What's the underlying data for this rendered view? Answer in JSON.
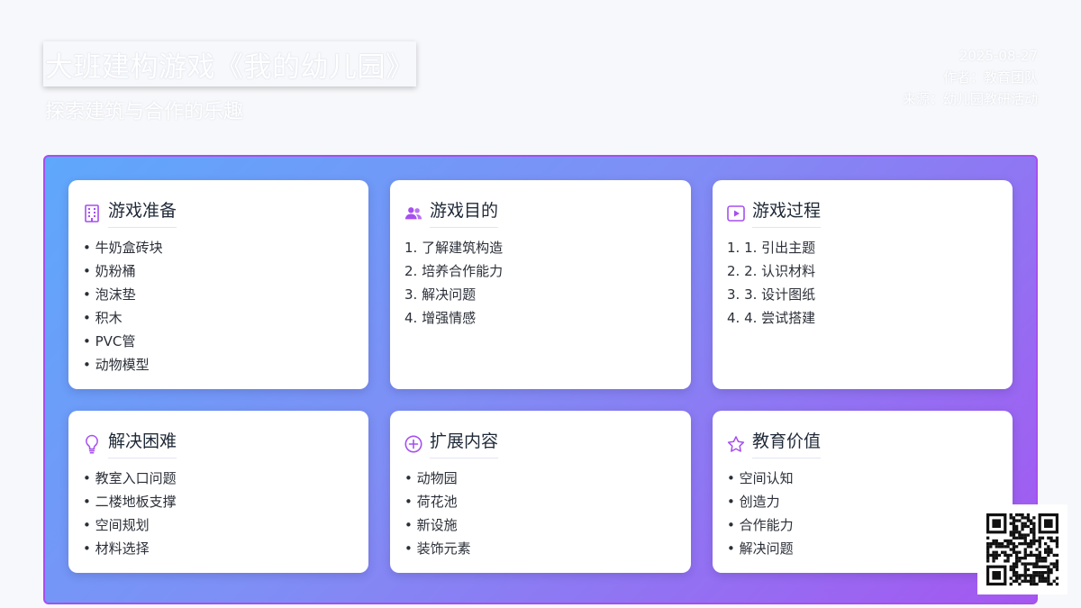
{
  "header": {
    "title": "大班建构游戏《我的幼儿园》",
    "subtitle": "探索建筑与合作的乐趣",
    "date": "2025-08-27",
    "author": "作者：教育团队",
    "source": "来源：幼儿园教研活动"
  },
  "cards": [
    {
      "title": "游戏准备",
      "icon": "building-icon",
      "items": [
        "• 牛奶盒砖块",
        "• 奶粉桶",
        "• 泡沫垫",
        "• 积木",
        "• PVC管",
        "• 动物模型"
      ]
    },
    {
      "title": "游戏目的",
      "icon": "users-icon",
      "items": [
        "1. 了解建筑构造",
        "2. 培养合作能力",
        "3. 解决问题",
        "4. 增强情感"
      ]
    },
    {
      "title": "游戏过程",
      "icon": "play-icon",
      "items": [
        "1. 1. 引出主题",
        "2. 2. 认识材料",
        "3. 3. 设计图纸",
        "4. 4. 尝试搭建"
      ]
    },
    {
      "title": "解决困难",
      "icon": "lightbulb-icon",
      "items": [
        "• 教室入口问题",
        "• 二楼地板支撑",
        "• 空间规划",
        "• 材料选择"
      ]
    },
    {
      "title": "扩展内容",
      "icon": "plus-circle-icon",
      "items": [
        "• 动物园",
        "• 荷花池",
        "• 新设施",
        "• 装饰元素"
      ]
    },
    {
      "title": "教育价值",
      "icon": "star-icon",
      "items": [
        "• 空间认知",
        "• 创造力",
        "• 合作能力",
        "• 解决问题"
      ]
    }
  ],
  "colors": {
    "accent": "#a64ff0",
    "gradient_start": "#5ea8fb",
    "gradient_end": "#a457f0"
  }
}
